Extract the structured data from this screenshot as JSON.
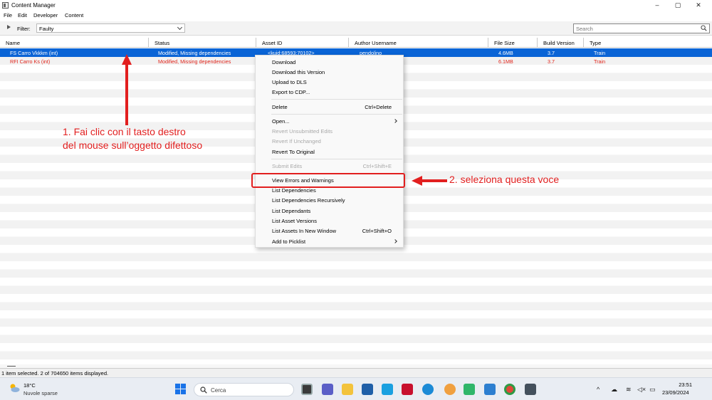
{
  "window": {
    "title": "Content Manager",
    "controls": [
      "–",
      "▢",
      "✕"
    ]
  },
  "menu": [
    "File",
    "Edit",
    "Developer",
    "Content"
  ],
  "filter": {
    "label": "Filter:",
    "value": "Faulty",
    "search_placeholder": "Search"
  },
  "columns": [
    "Name",
    "Status",
    "Asset ID",
    "Author Username",
    "File Size",
    "Build Version",
    "Type"
  ],
  "rows": [
    {
      "name": "FS Carro Vkkkm (int)",
      "status": "Modified, Missing dependencies",
      "asset_id": "<kuid:68593:70102>",
      "author": "pendolino",
      "size": "4.6MB",
      "build": "3.7",
      "type": "Train",
      "selected": true
    },
    {
      "name": "RFI Carro Ks (int)",
      "status": "Modified, Missing dependencies",
      "asset_id": "",
      "author": "",
      "size": "6.1MB",
      "build": "3.7",
      "type": "Train",
      "selected": false
    }
  ],
  "context_menu": [
    {
      "label": "Download"
    },
    {
      "label": "Download this Version"
    },
    {
      "label": "Upload to DLS"
    },
    {
      "label": "Export to CDP..."
    },
    {
      "label": "Delete",
      "shortcut": "Ctrl+Delete"
    },
    {
      "label": "Open...",
      "submenu": true
    },
    {
      "label": "Revert Unsubmitted Edits",
      "disabled": true
    },
    {
      "label": "Revert If Unchanged",
      "disabled": true
    },
    {
      "label": "Revert To Original"
    },
    {
      "label": "Submit Edits",
      "shortcut": "Ctrl+Shift+E",
      "disabled": true
    },
    {
      "label": "View Errors and Warnings",
      "highlighted": true
    },
    {
      "label": "List Dependencies"
    },
    {
      "label": "List Dependencies Recursively"
    },
    {
      "label": "List Dependants"
    },
    {
      "label": "List Asset Versions"
    },
    {
      "label": "List Assets In New Window",
      "shortcut": "Ctrl+Shift+O"
    },
    {
      "label": "Add to Picklist",
      "submenu": true
    }
  ],
  "status_bar": "1 item selected. 2 of 704650 items displayed.",
  "annotations": {
    "step1_line1": "1. Fai clic con il tasto destro",
    "step1_line2": "del mouse sull’oggetto difettoso",
    "step2": "2. seleziona questa voce",
    "color": "#e21f1f"
  },
  "taskbar": {
    "weather_temp": "18°C",
    "weather_desc": "Nuvole sparse",
    "search_label": "Cerca",
    "time": "23:51",
    "date": "23/09/2024",
    "apps": [
      "file-explorer-icon",
      "teams-icon",
      "folder-icon",
      "store-icon",
      "myfly-icon",
      "mcafee-icon",
      "edge-icon",
      "copilot-icon",
      "app-green-icon",
      "notepad-icon",
      "chrome-icon",
      "content-manager-icon"
    ]
  },
  "colors": {
    "selection": "#0a64d6",
    "faulty_text": "#e1261c"
  }
}
